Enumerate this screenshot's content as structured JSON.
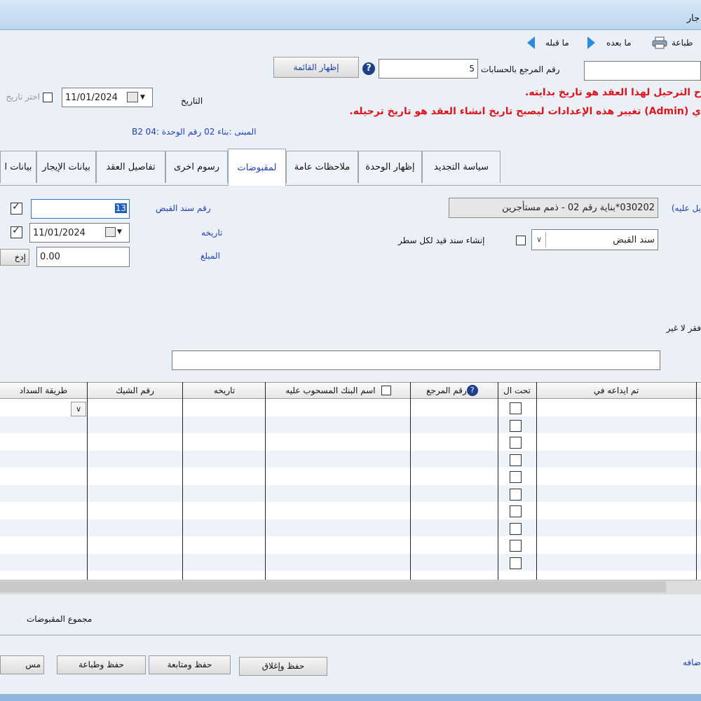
{
  "window": {
    "title": "جار"
  },
  "toolbar": {
    "print": "طباعة",
    "next": "ما بعده",
    "prev": "ما قبله"
  },
  "header": {
    "account_ref_label": "رقم المرجع بالحسابات",
    "account_ref_value": "5",
    "show_list_button": "إظهار القائمة",
    "date_label": "التاريخ",
    "date_value": "11/01/2024",
    "choose_date_label": "اختر تاريخ",
    "warning_line1": "ح الترحيل لهذا العقد هو تاريخ بدايته.",
    "warning_line2": "ي (Admin) تغيير هذه الإعدادات ليصبح تاريخ انشاء العقد هو تاريخ ترحيله.",
    "building_info": "المبنى :بناء 02  رقم الوحدة  :B2 04"
  },
  "tabs": [
    {
      "label": "سياسة التجديد"
    },
    {
      "label": "إظهار الوحدة"
    },
    {
      "label": "ملاحظات عامة"
    },
    {
      "label": "لمقبوضات"
    },
    {
      "label": "رسوم اخرى"
    },
    {
      "label": "تفاصيل العقد"
    },
    {
      "label": "بيانات الإيجار"
    },
    {
      "label": "بيانات ا"
    }
  ],
  "receipts": {
    "charged_label": "يل عليه)",
    "charged_value": "030202*بناية رقم 02 - ذمم مستأجرين",
    "voucher_type_value": "سند القبض",
    "create_entry_label": "إنشاء سند قيد لكل سطر",
    "receipt_no_label": "رقم سند القبض",
    "receipt_no_value": "13",
    "date_label": "تاريخه",
    "date_value": "11/01/2024",
    "amount_label": "المبلغ",
    "amount_value": "0.00",
    "enter_button": "إدخ",
    "only_label": "فقر لا غير",
    "amount_words_value": ""
  },
  "table": {
    "columns": [
      "تم ايداعه في",
      "تحت ال",
      "رقم المرجع",
      "اسم البنك المسحوب عليه",
      "تاريخه",
      "رقم الشيك",
      "طريقة السداد"
    ],
    "row_count": 11
  },
  "footer": {
    "total_label": "مجموع المقبوضات",
    "save_close": "حفظ وإغلاق",
    "save_continue": "حفظ ومتابعة",
    "save_print": "حفظ وطباعة",
    "other_button": "مس",
    "add_label": "ضافه"
  },
  "colors": {
    "accent": "#2a8ce0",
    "warning": "#e0141c",
    "label_blue": "#1f3fbf"
  }
}
